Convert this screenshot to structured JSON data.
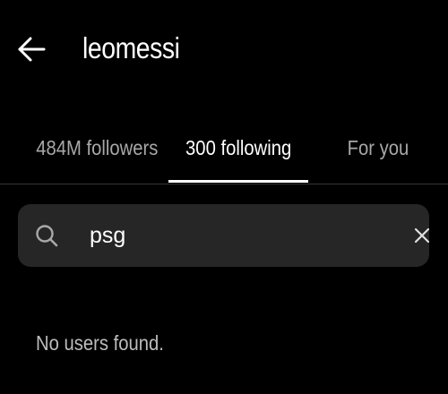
{
  "header": {
    "back_icon": "arrow-left-icon",
    "username": "leomessi"
  },
  "tabs": [
    {
      "label": "484M followers",
      "active": false
    },
    {
      "label": "300 following",
      "active": true
    },
    {
      "label": "For you",
      "active": false
    }
  ],
  "search": {
    "icon": "search-icon",
    "value": "psg",
    "clear_icon": "close-icon"
  },
  "empty_state": {
    "message": "No users found."
  },
  "colors": {
    "background": "#000000",
    "search_bg": "#262626",
    "active_text": "#ffffff",
    "inactive_text": "#a8a8a8",
    "divider": "#363636"
  }
}
